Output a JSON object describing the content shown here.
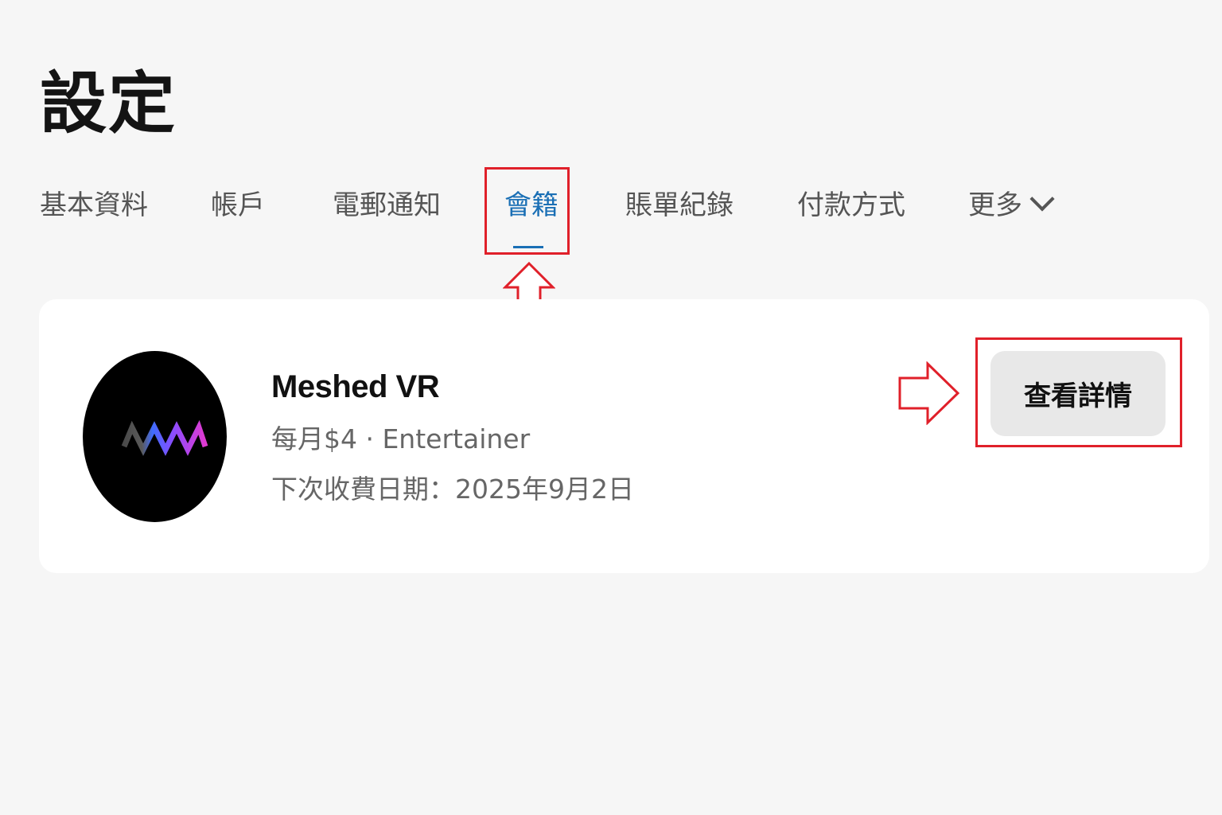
{
  "page": {
    "title": "設定"
  },
  "tabs": [
    {
      "label": "基本資料",
      "active": false
    },
    {
      "label": "帳戶",
      "active": false
    },
    {
      "label": "電郵通知",
      "active": false
    },
    {
      "label": "會籍",
      "active": true
    },
    {
      "label": "賬單紀錄",
      "active": false
    },
    {
      "label": "付款方式",
      "active": false
    },
    {
      "label": "更多",
      "active": false,
      "icon": "chevron-down-icon"
    }
  ],
  "membership": {
    "name": "Meshed VR",
    "price_tier": "每月$4 · Entertainer",
    "next_billing": "下次收費日期：2025年9月2日",
    "logo_icon": "meshed-vr-logo",
    "view_details_label": "查看詳情"
  },
  "colors": {
    "accent": "#1a6fb5",
    "annotation": "#e0202a",
    "background": "#f6f6f6",
    "card": "#ffffff",
    "button": "#e8e8e8"
  }
}
